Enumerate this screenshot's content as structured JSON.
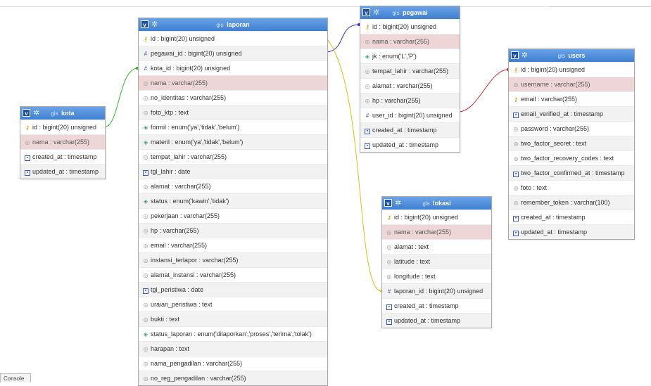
{
  "tables": {
    "kota": {
      "db": "gis",
      "name": "kota",
      "columns": [
        {
          "text": "id : bigint(20) unsigned",
          "icon": "primary-key-icon"
        },
        {
          "text": "nama : varchar(255)",
          "icon": "column-icon"
        },
        {
          "text": "created_at : timestamp",
          "icon": "datetime-icon"
        },
        {
          "text": "updated_at : timestamp",
          "icon": "datetime-icon"
        }
      ]
    },
    "laporan": {
      "db": "gis",
      "name": "laporan",
      "columns": [
        {
          "text": "id : bigint(20) unsigned",
          "icon": "primary-key-icon"
        },
        {
          "text": "pegawai_id : bigint(20) unsigned",
          "icon": "foreign-key-icon"
        },
        {
          "text": "kota_id : bigint(20) unsigned",
          "icon": "foreign-key-icon"
        },
        {
          "text": "nama : varchar(255)",
          "icon": "column-icon"
        },
        {
          "text": "no_identitas : varchar(255)",
          "icon": "column-icon"
        },
        {
          "text": "foto_ktp : text",
          "icon": "column-icon"
        },
        {
          "text": "formil : enum('ya','tidak','belum')",
          "icon": "enum-icon"
        },
        {
          "text": "materil : enum('ya','tidak','belum')",
          "icon": "enum-icon"
        },
        {
          "text": "tempat_lahir : varchar(255)",
          "icon": "column-icon"
        },
        {
          "text": "tgl_lahir : date",
          "icon": "datetime-icon"
        },
        {
          "text": "alamat : varchar(255)",
          "icon": "column-icon"
        },
        {
          "text": "status : enum('kawin','tidak')",
          "icon": "enum-icon"
        },
        {
          "text": "pekerjaan : varchar(255)",
          "icon": "column-icon"
        },
        {
          "text": "hp : varchar(255)",
          "icon": "column-icon"
        },
        {
          "text": "email : varchar(255)",
          "icon": "column-icon"
        },
        {
          "text": "instansi_terlapor : varchar(255)",
          "icon": "column-icon"
        },
        {
          "text": "alamat_instansi : varchar(255)",
          "icon": "column-icon"
        },
        {
          "text": "tgl_peristiwa : date",
          "icon": "datetime-icon"
        },
        {
          "text": "uraian_peristiwa : text",
          "icon": "column-icon"
        },
        {
          "text": "bukti : text",
          "icon": "column-icon"
        },
        {
          "text": "status_laporan : enum('dilaporkan','proses','terima','tolak')",
          "icon": "enum-icon"
        },
        {
          "text": "harapan : text",
          "icon": "column-icon"
        },
        {
          "text": "nama_pengadilan : varchar(255)",
          "icon": "column-icon"
        },
        {
          "text": "no_reg_pengadilan : varchar(255)",
          "icon": "column-icon"
        }
      ]
    },
    "pegawai": {
      "db": "gis",
      "name": "pegawai",
      "columns": [
        {
          "text": "id : bigint(20) unsigned",
          "icon": "primary-key-icon"
        },
        {
          "text": "nama : varchar(255)",
          "icon": "column-icon"
        },
        {
          "text": "jk : enum('L','P')",
          "icon": "enum-icon"
        },
        {
          "text": "tempat_lahir : varchar(255)",
          "icon": "column-icon"
        },
        {
          "text": "alamat : varchar(255)",
          "icon": "column-icon"
        },
        {
          "text": "hp : varchar(255)",
          "icon": "column-icon"
        },
        {
          "text": "user_id : bigint(20) unsigned",
          "icon": "foreign-key-icon"
        },
        {
          "text": "created_at : timestamp",
          "icon": "datetime-icon"
        },
        {
          "text": "updated_at : timestamp",
          "icon": "datetime-icon"
        }
      ]
    },
    "lokasi": {
      "db": "gis",
      "name": "lokasi",
      "columns": [
        {
          "text": "id : bigint(20) unsigned",
          "icon": "primary-key-icon"
        },
        {
          "text": "nama : varchar(255)",
          "icon": "column-icon"
        },
        {
          "text": "alamat : text",
          "icon": "column-icon"
        },
        {
          "text": "latitude : text",
          "icon": "column-icon"
        },
        {
          "text": "longitude : text",
          "icon": "column-icon"
        },
        {
          "text": "laporan_id : bigint(20) unsigned",
          "icon": "foreign-key-icon"
        },
        {
          "text": "created_at : timestamp",
          "icon": "datetime-icon"
        },
        {
          "text": "updated_at : timestamp",
          "icon": "datetime-icon"
        }
      ]
    },
    "users": {
      "db": "gis",
      "name": "users",
      "columns": [
        {
          "text": "id : bigint(20) unsigned",
          "icon": "primary-key-icon"
        },
        {
          "text": "username : varchar(255)",
          "icon": "column-icon"
        },
        {
          "text": "email : varchar(255)",
          "icon": "unique-key-icon"
        },
        {
          "text": "email_verified_at : timestamp",
          "icon": "datetime-icon"
        },
        {
          "text": "password : varchar(255)",
          "icon": "column-icon"
        },
        {
          "text": "two_factor_secret : text",
          "icon": "column-icon"
        },
        {
          "text": "two_factor_recovery_codes : text",
          "icon": "column-icon"
        },
        {
          "text": "two_factor_confirmed_at : timestamp",
          "icon": "datetime-icon"
        },
        {
          "text": "foto : text",
          "icon": "column-icon"
        },
        {
          "text": "remember_token : varchar(100)",
          "icon": "column-icon"
        },
        {
          "text": "created_at : timestamp",
          "icon": "datetime-icon"
        },
        {
          "text": "updated_at : timestamp",
          "icon": "datetime-icon"
        }
      ]
    }
  },
  "relation_colors": {
    "kota": "#2fb32f",
    "pegawai": "#2a2ad0",
    "lokasi": "#d8c21a",
    "users": "#c62a2a"
  },
  "console_label": "Console"
}
